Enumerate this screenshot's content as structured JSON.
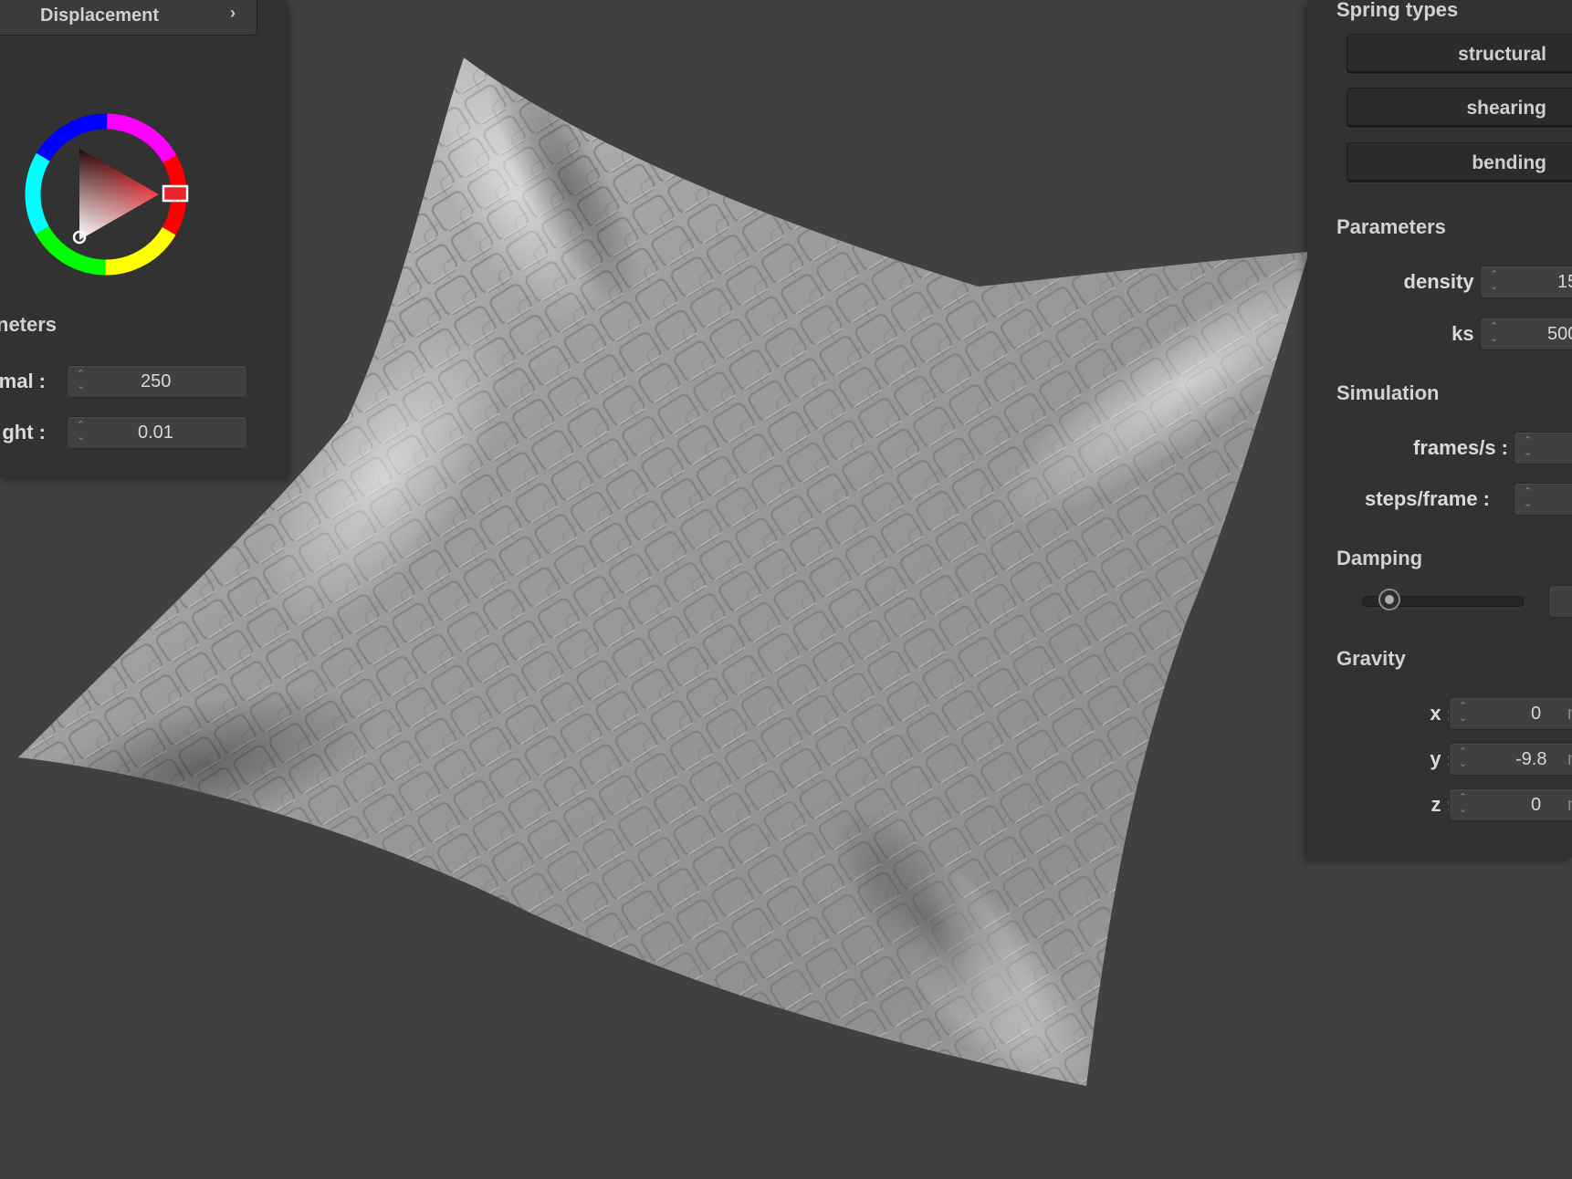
{
  "left_panel": {
    "displacement_label": "Displacement",
    "chevron_glyph": "›",
    "section_title": "neters",
    "rows": [
      {
        "label": "mal :",
        "value": "250"
      },
      {
        "label": "ght :",
        "value": "0.01"
      }
    ],
    "color_picker": {
      "hue_color": "#e8232a"
    }
  },
  "right_panel": {
    "spring_types_title": "Spring types",
    "spring_buttons": [
      "structural",
      "shearing",
      "bending"
    ],
    "parameters_title": "Parameters",
    "parameters": [
      {
        "label": "density :",
        "value": "15"
      },
      {
        "label": "ks :",
        "value": "500"
      }
    ],
    "simulation_title": "Simulation",
    "simulation": [
      {
        "label": "frames/s :",
        "value": ""
      },
      {
        "label": "steps/frame :",
        "value": ""
      }
    ],
    "damping_title": "Damping",
    "damping_level": 0.17,
    "gravity_title": "Gravity",
    "gravity": [
      {
        "label": "x :",
        "value": "0",
        "unit": "m"
      },
      {
        "label": "y :",
        "value": "-9.8",
        "unit": "m"
      },
      {
        "label": "z :",
        "value": "0",
        "unit": "m"
      }
    ]
  }
}
